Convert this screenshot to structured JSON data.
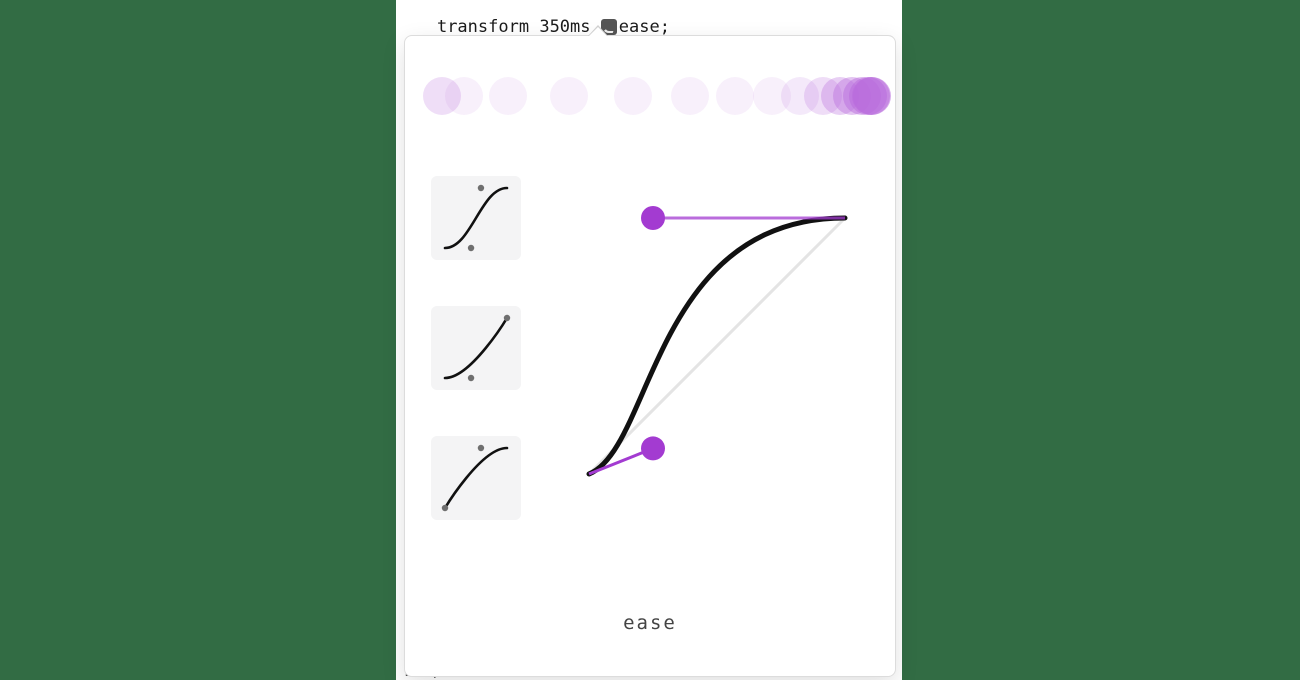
{
  "code_line": {
    "property": "transform",
    "duration": "350ms",
    "easing_token": "ease",
    "tail": ";"
  },
  "popover": {
    "selected_curve_name": "ease",
    "bezier": {
      "p1x": 0.25,
      "p1y": 0.1,
      "p2x": 0.25,
      "p2y": 1.0
    },
    "presets": [
      {
        "id": "ease-in-out",
        "p1x": 0.42,
        "p1y": 0.0,
        "p2x": 0.58,
        "p2y": 1.0
      },
      {
        "id": "ease-in",
        "p1x": 0.42,
        "p1y": 0.0,
        "p2x": 1.0,
        "p2y": 1.0
      },
      {
        "id": "ease-out",
        "p1x": 0.0,
        "p1y": 0.0,
        "p2x": 0.58,
        "p2y": 1.0
      }
    ],
    "trail_dot_count": 16,
    "accent_color": "#a33bd1",
    "trail_base_color": "#b86bdc"
  },
  "stray_tail_text": "...,"
}
